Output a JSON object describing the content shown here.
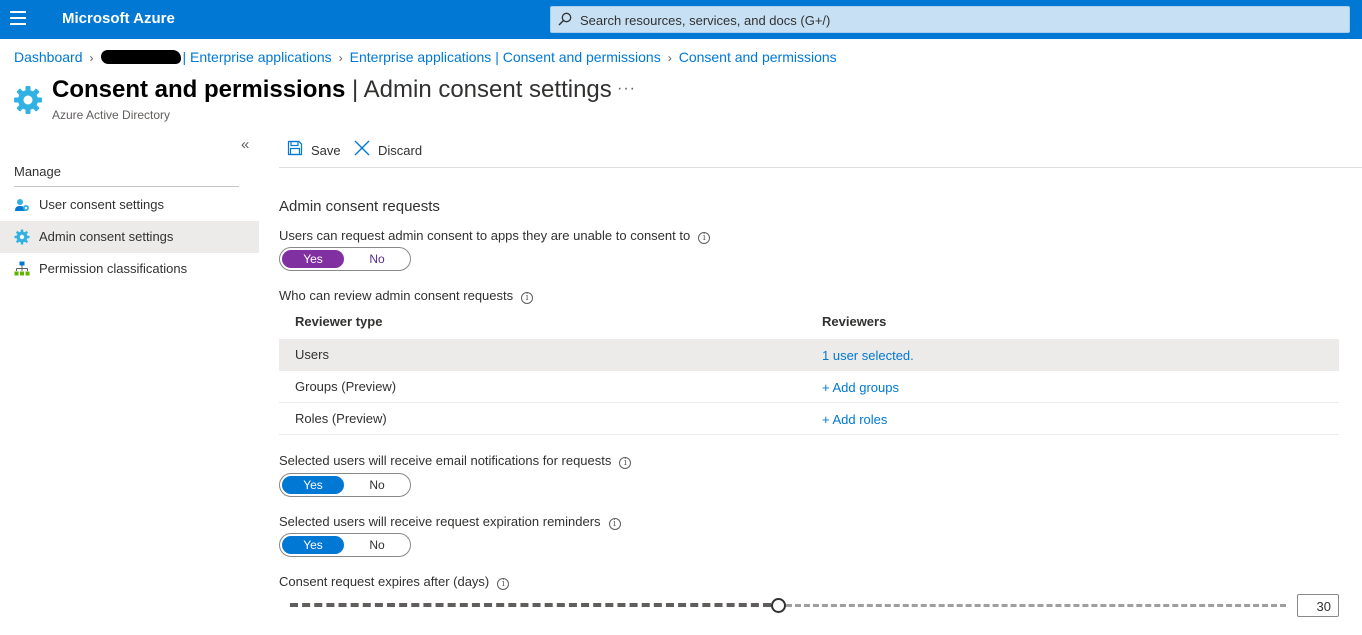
{
  "topbar": {
    "brand": "Microsoft Azure",
    "search_placeholder": "Search resources, services, and docs (G+/)"
  },
  "breadcrumb": {
    "items": [
      "Dashboard",
      "Enterprise applications",
      "Enterprise applications | Consent and permissions",
      "Consent and permissions"
    ]
  },
  "header": {
    "title_bold": "Consent and permissions",
    "title_rest": " | Admin consent settings",
    "subtitle": "Azure Active Directory",
    "more": "···"
  },
  "sidebar": {
    "collapse": "«",
    "section": "Manage",
    "items": [
      {
        "label": "User consent settings",
        "icon": "user-gear-icon"
      },
      {
        "label": "Admin consent settings",
        "icon": "gear-icon"
      },
      {
        "label": "Permission classifications",
        "icon": "hierarchy-icon"
      }
    ]
  },
  "toolbar": {
    "save_label": "Save",
    "discard_label": "Discard"
  },
  "content": {
    "section_title": "Admin consent requests",
    "q_request": "Users can request admin consent to apps they are unable to consent to",
    "q_review": "Who can review admin consent requests",
    "q_email": "Selected users will receive email notifications for requests",
    "q_reminders": "Selected users will receive request expiration reminders",
    "q_expires": "Consent request expires after (days)",
    "toggle_yes": "Yes",
    "toggle_no": "No",
    "info_glyph": "i",
    "table": {
      "headers": [
        "Reviewer type",
        "Reviewers"
      ],
      "rows": [
        {
          "type": "Users",
          "value": "1 user selected."
        },
        {
          "type": "Groups (Preview)",
          "value": "+ Add groups"
        },
        {
          "type": "Roles (Preview)",
          "value": "+ Add roles"
        }
      ]
    },
    "expiry_days": "30",
    "expiry_fraction": 0.49
  },
  "colors": {
    "brand": "#0078d4",
    "toggle_purple": "#8130a1",
    "toggle_blue": "#0078d4"
  }
}
